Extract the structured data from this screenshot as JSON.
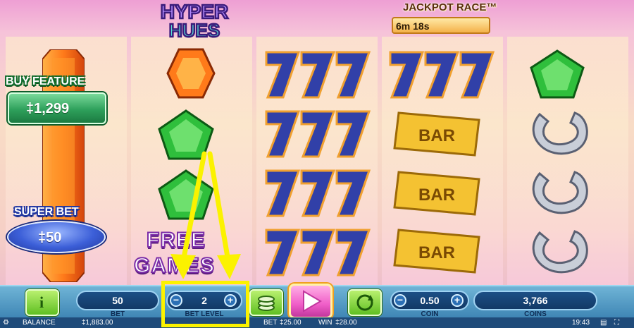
{
  "game": {
    "title_line1": "HYPER",
    "title_line2": "HUES"
  },
  "jackpot": {
    "title": "JACKPOT RACE™",
    "timer": "6m 18s"
  },
  "buy_feature": {
    "title": "BUY FEATURE",
    "price": "‡1,299"
  },
  "super_bet": {
    "title": "SUPER BET",
    "price": "‡50"
  },
  "free_games": {
    "line1": "FREE",
    "line2": "GAMES"
  },
  "reels": [
    [
      "orange-gem",
      "orange-gem",
      "orange-gem",
      "orange-gem"
    ],
    [
      "orange-gem",
      "green-gem",
      "green-gem",
      "free-games"
    ],
    [
      "seven",
      "seven",
      "seven",
      "seven"
    ],
    [
      "seven",
      "bar",
      "bar",
      "bar"
    ],
    [
      "green-gem",
      "horseshoe",
      "horseshoe",
      "horseshoe"
    ]
  ],
  "symbol_text": {
    "bar": "BAR"
  },
  "controls": {
    "info_label": "i",
    "bet_value": "50",
    "bet_label": "BET",
    "bet_level_value": "2",
    "bet_level_label": "BET LEVEL",
    "minus": "−",
    "plus": "+",
    "coin_value": "0.50",
    "coin_label": "COIN",
    "coins_value": "3,766",
    "coins_label": "COINS"
  },
  "status": {
    "balance_label": "BALANCE",
    "balance_value": "‡1,883.00",
    "bet_label": "BET",
    "bet_value": "‡25.00",
    "win_label": "WIN",
    "win_value": "‡28.00",
    "time": "19:43"
  },
  "colors": {
    "highlight": "#fbf200",
    "accent": "#f05ec8"
  }
}
